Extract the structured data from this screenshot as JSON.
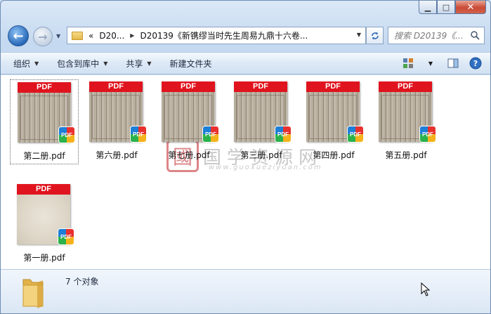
{
  "window": {
    "caption": {
      "minimize_glyph": "▁",
      "maximize_glyph": "□",
      "close_glyph": "✕"
    }
  },
  "nav": {
    "back_glyph": "←",
    "forward_glyph": "→",
    "address": {
      "crumb_prefix": "«",
      "crumb_parent": "D20...",
      "crumb_current": "D20139《新镌缪当时先生周易九鼎十六卷..."
    },
    "search_placeholder": "搜索 D20139《..."
  },
  "toolbar": {
    "organize": "组织",
    "include_in_library": "包含到库中",
    "share": "共享",
    "new_folder": "新建文件夹"
  },
  "files": [
    {
      "name": "第二册.pdf",
      "thumb_label": "PDF",
      "badge": "PDF",
      "selected": true
    },
    {
      "name": "第六册.pdf",
      "thumb_label": "PDF",
      "badge": "PDF"
    },
    {
      "name": "第七册.pdf",
      "thumb_label": "PDF",
      "badge": "PDF"
    },
    {
      "name": "第三册.pdf",
      "thumb_label": "PDF",
      "badge": "PDF"
    },
    {
      "name": "第四册.pdf",
      "thumb_label": "PDF",
      "badge": "PDF"
    },
    {
      "name": "第五册.pdf",
      "thumb_label": "PDF",
      "badge": "PDF"
    },
    {
      "name": "第一册.pdf",
      "thumb_label": "PDF",
      "badge": "PDF"
    }
  ],
  "watermark": {
    "seal": "國",
    "title": "国学资源网",
    "url": "www.guoxueziyuan.com"
  },
  "status": {
    "count_text": "7 个对象"
  },
  "colors": {
    "pdf_red": "#e0141e",
    "window_border": "#6d8db4",
    "close_red": "#c94a36"
  }
}
